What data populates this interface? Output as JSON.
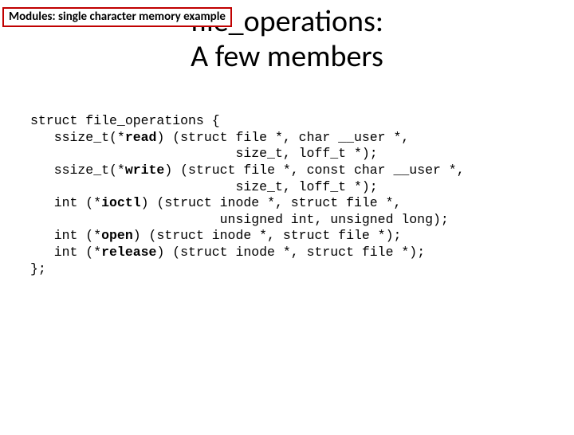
{
  "tag": "Modules: single character memory example",
  "title_line1": "file_operations:",
  "title_line2": "A few members",
  "code": {
    "l1": "struct file_operations {",
    "l2a": "   ssize_t(*",
    "l2b": "read",
    "l2c": ") (struct file *, char __user *,",
    "l3": "                          size_t, loff_t *);",
    "l4a": "   ssize_t(*",
    "l4b": "write",
    "l4c": ") (struct file *, const char __user *,",
    "l5": "                          size_t, loff_t *);",
    "l6a": "   int (*",
    "l6b": "ioctl",
    "l6c": ") (struct inode *, struct file *,",
    "l7": "                        unsigned int, unsigned long);",
    "l8a": "   int (*",
    "l8b": "open",
    "l8c": ") (struct inode *, struct file *);",
    "l9a": "   int (*",
    "l9b": "release",
    "l9c": ") (struct inode *, struct file *);",
    "l10": "};"
  }
}
